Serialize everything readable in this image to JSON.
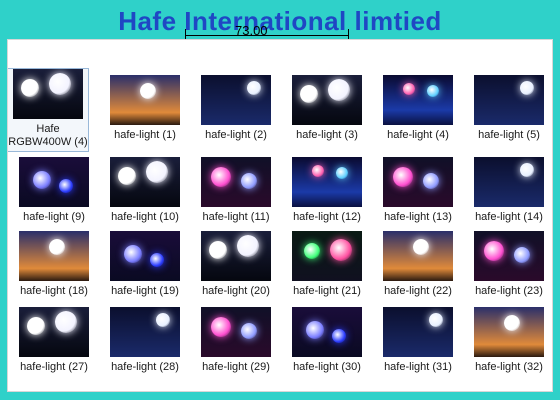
{
  "banner": {
    "title": "Hafe International limtied",
    "measure": "73.00"
  },
  "items": [
    {
      "label": "Hafe RGBW400W (4)",
      "scene": "white-orbs",
      "selected": true
    },
    {
      "label": "hafe-light (1)",
      "scene": "sunset"
    },
    {
      "label": "hafe-light (2)",
      "scene": "night-blue"
    },
    {
      "label": "hafe-light (3)",
      "scene": "white-orbs"
    },
    {
      "label": "hafe-light (4)",
      "scene": "blue-city"
    },
    {
      "label": "hafe-light (5)",
      "scene": "night-blue"
    },
    {
      "label": "hafe-light (9)",
      "scene": "blue-orbs"
    },
    {
      "label": "hafe-light (10)",
      "scene": "white-orbs"
    },
    {
      "label": "hafe-light (11)",
      "scene": "pink-orbs"
    },
    {
      "label": "hafe-light (12)",
      "scene": "blue-city"
    },
    {
      "label": "hafe-light (13)",
      "scene": "pink-orbs"
    },
    {
      "label": "hafe-light (14)",
      "scene": "night-blue"
    },
    {
      "label": "hafe-light (18)",
      "scene": "sunset"
    },
    {
      "label": "hafe-light (19)",
      "scene": "blue-orbs"
    },
    {
      "label": "hafe-light (20)",
      "scene": "white-orbs"
    },
    {
      "label": "hafe-light (21)",
      "scene": "green-pink"
    },
    {
      "label": "hafe-light (22)",
      "scene": "sunset"
    },
    {
      "label": "hafe-light (23)",
      "scene": "pink-orbs"
    },
    {
      "label": "hafe-light (27)",
      "scene": "white-orbs"
    },
    {
      "label": "hafe-light (28)",
      "scene": "night-blue"
    },
    {
      "label": "hafe-light (29)",
      "scene": "pink-orbs"
    },
    {
      "label": "hafe-light (30)",
      "scene": "blue-orbs"
    },
    {
      "label": "hafe-light (31)",
      "scene": "night-blue"
    },
    {
      "label": "hafe-light (32)",
      "scene": "sunset"
    }
  ],
  "colors": {
    "background": "#2fd1c9",
    "banner": "#1f47c4"
  }
}
